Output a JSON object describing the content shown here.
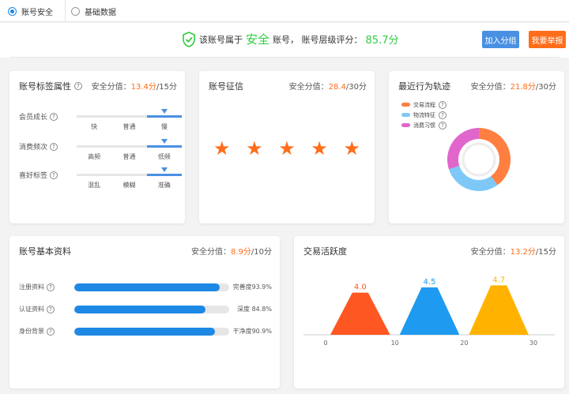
{
  "tabs": [
    {
      "label": "账号安全",
      "selected": true
    },
    {
      "label": "基础数据",
      "selected": false
    }
  ],
  "banner": {
    "prefix": "该账号属于",
    "level": "安全",
    "middle": "账号， 账号层级评分：",
    "score": "85.7分",
    "join_button": "加入分组",
    "report_button": "我要举报"
  },
  "tag_card": {
    "title": "账号标签属性",
    "help": "?",
    "score_prefix": "安全分值：",
    "score_value": "13.4分",
    "score_total": "/15分",
    "rows": [
      {
        "label": "会员成长",
        "options": [
          "快",
          "普通",
          "慢"
        ],
        "selected": 2
      },
      {
        "label": "消费频次",
        "options": [
          "高频",
          "普通",
          "低频"
        ],
        "selected": 2
      },
      {
        "label": "喜好标签",
        "options": [
          "混乱",
          "模糊",
          "准确"
        ],
        "selected": 2
      }
    ]
  },
  "credit_card": {
    "title": "账号征信",
    "score_prefix": "安全分值：",
    "score_value": "28.4",
    "score_total": "/30分",
    "stars": 5
  },
  "behavior_card": {
    "title": "最近行为轨迹",
    "score_prefix": "安全分值：",
    "score_value": "21.8分",
    "score_total": "/30分",
    "legend": [
      {
        "label": "交易流程",
        "color": "#ff7f40"
      },
      {
        "label": "物流特征",
        "color": "#7ec8f7"
      },
      {
        "label": "消费习惯",
        "color": "#e066cc"
      }
    ],
    "donut": [
      {
        "name": "交易流程",
        "fraction": 0.4,
        "color": "#ff7f40"
      },
      {
        "name": "物流特征",
        "fraction": 0.3,
        "color": "#7ec8f7"
      },
      {
        "name": "消费习惯",
        "fraction": 0.3,
        "color": "#e066cc"
      }
    ]
  },
  "profile_card": {
    "title": "账号基本资料",
    "score_prefix": "安全分值：",
    "score_value": "8.9分",
    "score_total": "/10分",
    "rows": [
      {
        "label": "注册资料",
        "value": 0.939,
        "text": "完善度93.9%"
      },
      {
        "label": "认证资料",
        "value": 0.848,
        "text": "深度 84.8%"
      },
      {
        "label": "身份背景",
        "value": 0.909,
        "text": "干净度90.9%"
      }
    ]
  },
  "activity_card": {
    "title": "交易活跃度",
    "score_prefix": "安全分值：",
    "score_value": "13.2分",
    "score_total": "/15分"
  },
  "chart_data": {
    "type": "area",
    "x_ticks": [
      "0",
      "10",
      "20",
      "30"
    ],
    "xlim": [
      0,
      30
    ],
    "series": [
      {
        "center": 5,
        "span": [
          0,
          10
        ],
        "value": 4.0,
        "label": "4.0",
        "color": "#ff5722"
      },
      {
        "center": 15,
        "span": [
          10,
          20
        ],
        "value": 4.5,
        "label": "4.5",
        "color": "#1e9bf0"
      },
      {
        "center": 25,
        "span": [
          20,
          30
        ],
        "value": 4.7,
        "label": "4.7",
        "color": "#ffb300"
      }
    ],
    "ylim": [
      0,
      6
    ]
  },
  "colors": {
    "accent": "#ff6d1a",
    "safe": "#2ecc40",
    "blue": "#4a90e2"
  }
}
